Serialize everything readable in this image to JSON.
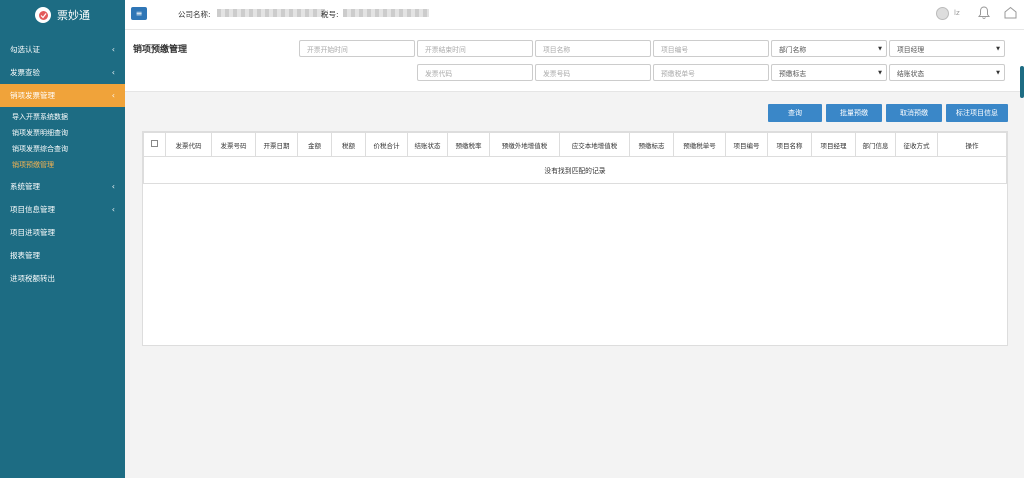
{
  "sidebar": {
    "logo": "票妙通",
    "items": [
      {
        "label": "勾选认证",
        "chevron": true,
        "active": false
      },
      {
        "label": "发票查验",
        "chevron": true,
        "active": false
      },
      {
        "label": "销项发票管理",
        "chevron": true,
        "active": true
      },
      {
        "label": "系统管理",
        "chevron": true,
        "active": false
      },
      {
        "label": "项目信息管理",
        "chevron": true,
        "active": false
      },
      {
        "label": "项目进项管理",
        "chevron": false,
        "active": false
      },
      {
        "label": "报表管理",
        "chevron": false,
        "active": false
      },
      {
        "label": "进项税额转出",
        "chevron": false,
        "active": false
      }
    ],
    "subitems": [
      {
        "label": "导入开票系统数据",
        "current": false
      },
      {
        "label": "销项发票明细查询",
        "current": false
      },
      {
        "label": "销项发票综合查询",
        "current": false
      },
      {
        "label": "销项预缴管理",
        "current": true
      }
    ]
  },
  "header": {
    "company_label": "公司名称:",
    "tax_label": "税号:",
    "user": "lz"
  },
  "page": {
    "title": "销项预缴管理",
    "filters_row1": [
      "开票开始时间",
      "开票结束时间",
      "项目名称",
      "项目编号",
      "部门名称",
      "项目经理"
    ],
    "filters_row2": [
      "发票代码",
      "发票号码",
      "预缴税单号",
      "预缴标志",
      "结账状态"
    ],
    "selects": [
      "部门名称",
      "项目经理",
      "预缴标志",
      "结账状态"
    ],
    "buttons": [
      "查询",
      "批量预缴",
      "取消预缴",
      "标注项目信息"
    ]
  },
  "table": {
    "columns": [
      "发票代码",
      "发票号码",
      "开票日期",
      "金额",
      "税额",
      "价税合计",
      "结账状态",
      "预缴税率",
      "预缴外地增值税",
      "应交本地增值税",
      "预缴标志",
      "预缴税单号",
      "项目编号",
      "项目名称",
      "项目经理",
      "部门信息",
      "征收方式",
      "操作"
    ],
    "empty_text": "没有找到匹配的记录"
  },
  "colors": {
    "sidebar": "#1d6c83",
    "active": "#f0a33a",
    "button": "#3a87c8"
  }
}
